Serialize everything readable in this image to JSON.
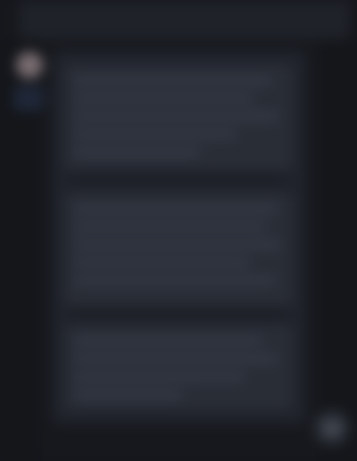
{
  "theme": {
    "background": "#16181d",
    "surface": "#20232b",
    "content_block": "#292d36",
    "avatar_color": "#7a6e72"
  },
  "message": {
    "blocks": [
      {
        "text": ""
      },
      {
        "text": ""
      },
      {
        "text": ""
      }
    ]
  },
  "icons": {
    "avatar": "avatar",
    "scroll": "scroll-down-icon"
  }
}
